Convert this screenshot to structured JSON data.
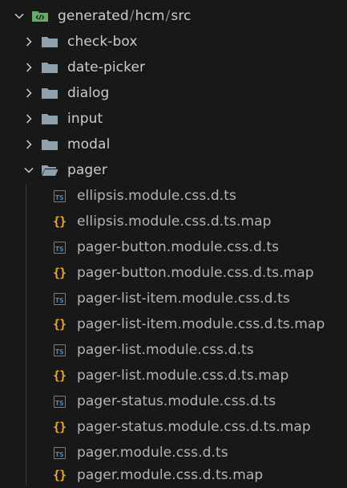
{
  "root": {
    "path_parts": [
      "generated",
      "hcm",
      "src"
    ],
    "separator": "/"
  },
  "folders": [
    {
      "label": "check-box",
      "expanded": false
    },
    {
      "label": "date-picker",
      "expanded": false
    },
    {
      "label": "dialog",
      "expanded": false
    },
    {
      "label": "input",
      "expanded": false
    },
    {
      "label": "modal",
      "expanded": false
    },
    {
      "label": "pager",
      "expanded": true
    }
  ],
  "pager_files": [
    {
      "label": "ellipsis.module.css.d.ts",
      "icon": "typescript-icon"
    },
    {
      "label": "ellipsis.module.css.d.ts.map",
      "icon": "json-braces-icon"
    },
    {
      "label": "pager-button.module.css.d.ts",
      "icon": "typescript-icon"
    },
    {
      "label": "pager-button.module.css.d.ts.map",
      "icon": "json-braces-icon"
    },
    {
      "label": "pager-list-item.module.css.d.ts",
      "icon": "typescript-icon"
    },
    {
      "label": "pager-list-item.module.css.d.ts.map",
      "icon": "json-braces-icon"
    },
    {
      "label": "pager-list.module.css.d.ts",
      "icon": "typescript-icon"
    },
    {
      "label": "pager-list.module.css.d.ts.map",
      "icon": "json-braces-icon"
    },
    {
      "label": "pager-status.module.css.d.ts",
      "icon": "typescript-icon"
    },
    {
      "label": "pager-status.module.css.d.ts.map",
      "icon": "json-braces-icon"
    },
    {
      "label": "pager.module.css.d.ts",
      "icon": "typescript-icon"
    },
    {
      "label": "pager.module.css.d.ts.map",
      "icon": "json-braces-icon"
    }
  ],
  "icon_glyphs": {
    "ts": "TS",
    "map": "{}"
  },
  "colors": {
    "background": "#181818",
    "text": "#cccccc",
    "folder": "#8ea1ad",
    "ts_blue": "#4e86c4",
    "json_orange": "#e6a937",
    "root_folder_green": "#6aa86b"
  }
}
